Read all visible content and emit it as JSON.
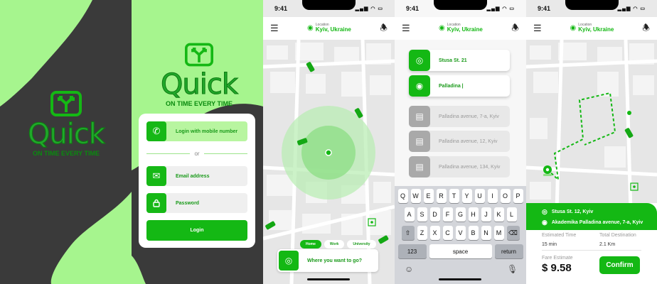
{
  "brand": {
    "name": "Quick",
    "tagline": "ON TIME EVERY TIME",
    "green": "#14b814",
    "lightgreen": "#a6f58e",
    "dark": "#3a3a3a"
  },
  "login": {
    "mobile_label": "Login with mobile number",
    "or_label": "or",
    "email_label": "Email address",
    "password_label": "Password",
    "login_button": "Login"
  },
  "status_bar": {
    "time": "9:41"
  },
  "app_bar": {
    "location_caption": "Location",
    "location_value": "Kyiv, Ukraine",
    "menu_icon": "menu-icon",
    "bell_icon": "bell-icon"
  },
  "home_screen": {
    "chips": [
      {
        "label": "Home",
        "active": true
      },
      {
        "label": "Work",
        "active": false
      },
      {
        "label": "University",
        "active": false
      }
    ],
    "search_placeholder": "Where you want to go?"
  },
  "search_screen": {
    "from": "Stusa St. 21",
    "to": "Palladina |",
    "suggestions": [
      "Palladina avenue, 7-a, Kyiv",
      "Palladina avenue, 12, Kyiv",
      "Palladina avenue, 134, Kyiv"
    ],
    "keyboard": {
      "row1": [
        "Q",
        "W",
        "E",
        "R",
        "T",
        "Y",
        "U",
        "I",
        "O",
        "P"
      ],
      "row2": [
        "A",
        "S",
        "D",
        "F",
        "G",
        "H",
        "J",
        "K",
        "L"
      ],
      "row3": [
        "Z",
        "X",
        "C",
        "V",
        "B",
        "N",
        "M"
      ],
      "num_key": "123",
      "space_key": "space",
      "return_key": "return"
    }
  },
  "route_screen": {
    "from": "Stusa St. 12, Kyiv",
    "to": "Akademika Palladina avenue, 7-a, Kyiv",
    "estimated_time_label": "Estimated Time",
    "estimated_time_value": "15 min",
    "total_destination_label": "Total Destination",
    "total_destination_value": "2.1 Km",
    "fare_label": "Fare Estimate",
    "fare_value": "$ 9.58",
    "confirm_button": "Confirm"
  }
}
